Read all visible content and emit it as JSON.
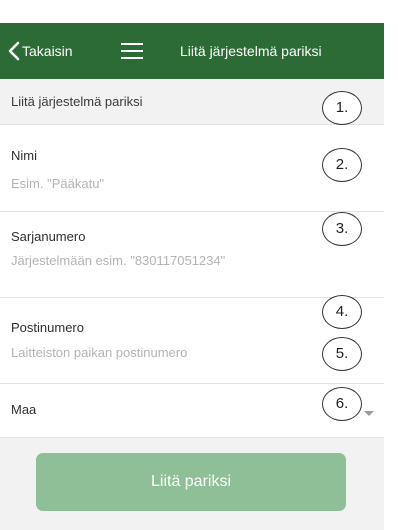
{
  "header": {
    "back_label": "Takaisin",
    "title": "Liitä järjestelmä pariksi",
    "background_color": "#2c6b36"
  },
  "section": {
    "label": "Liitä järjestelmä pariksi"
  },
  "fields": {
    "name": {
      "label": "Nimi",
      "placeholder": "Esim. \"Pääkatu\"",
      "value": ""
    },
    "serial": {
      "label": "Sarjanumero",
      "placeholder": "Järjestelmään esim. \"830117051234\"",
      "value": ""
    },
    "postal": {
      "label": "Postinumero",
      "placeholder": "Laitteiston paikan postinumero",
      "value": ""
    }
  },
  "country": {
    "label": "Maa"
  },
  "submit": {
    "label": "Liitä pariksi",
    "color": "#8fbf96"
  },
  "callouts": [
    "1.",
    "2.",
    "3.",
    "4.",
    "5.",
    "6."
  ],
  "icons": {
    "back": "chevron-left-icon",
    "menu": "hamburger-menu-icon",
    "dropdown": "caret-down-icon"
  }
}
